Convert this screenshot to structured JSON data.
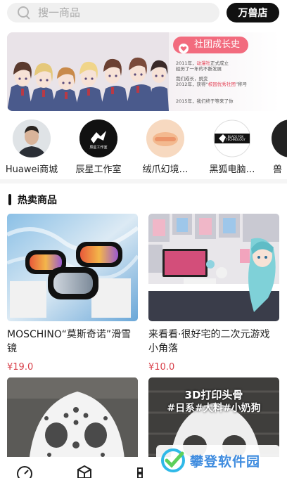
{
  "search": {
    "placeholder": "搜一商品"
  },
  "header": {
    "store_button": "万兽店"
  },
  "banner": {
    "badge": "社团成长史",
    "lines": [
      {
        "pre": "2011年，",
        "red": "动漫社",
        "post": "正式成立"
      },
      {
        "pre": "经历了一年的不断发展",
        "red": "",
        "post": ""
      },
      {
        "pre": "我们成长，蜕变",
        "red": "",
        "post": ""
      },
      {
        "pre": "2012年，获得“",
        "red": "校园优秀社团",
        "post": "”称号"
      },
      {
        "pre": "2015年，我们终于等来了你",
        "red": "",
        "post": ""
      }
    ]
  },
  "stores": [
    {
      "name": "Huawei商城",
      "icon": "person-avatar"
    },
    {
      "name": "辰星工作室",
      "icon": "studio-logo"
    },
    {
      "name": "绒爪幻境…",
      "icon": "plush-logo"
    },
    {
      "name": "黑狐电脑…",
      "icon": "black-fox-logo"
    },
    {
      "name": "兽",
      "icon": "partial-logo"
    }
  ],
  "store_logo_text": {
    "studio": "辰星工作室",
    "blackfox": "BLACK FOX TECHNOLOGY"
  },
  "hot": {
    "title": "热卖商品",
    "products": [
      {
        "title": "MOSCHINO“莫斯奇诺”滑雪镜",
        "price": "¥19.0"
      },
      {
        "title": "来看看·很好宅的二次元游戏小角落",
        "price": "¥10.0"
      },
      {
        "title": "",
        "price": ""
      },
      {
        "title": "",
        "price": ""
      }
    ]
  },
  "product_overlay": {
    "line1": "3D打印头骨",
    "line2": "#日系#大料#小奶狗"
  },
  "watermark": {
    "text": "攀登软件园"
  },
  "colors": {
    "accent": "#d8404a",
    "badge": "#f26b7e",
    "watermark": "#3f8cdf"
  }
}
